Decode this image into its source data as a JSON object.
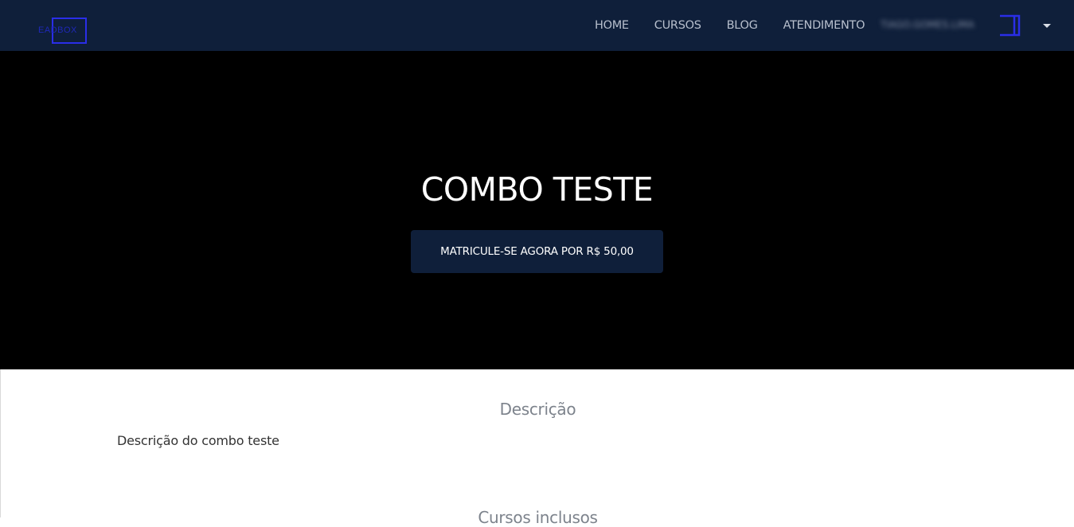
{
  "logo": {
    "text": "EADBOX",
    "accent_color": "#2a2ee8"
  },
  "nav": {
    "items": [
      {
        "label": "HOME"
      },
      {
        "label": "CURSOS"
      },
      {
        "label": "BLOG"
      },
      {
        "label": "ATENDIMENTO"
      }
    ],
    "user_name": "TIAGO.GOMES.LIMA",
    "user_icon": "user-avatar-icon",
    "menu_icon": "caret-down-icon"
  },
  "hero": {
    "title": "COMBO TESTE",
    "enroll_label": "MATRICULE-SE AGORA POR R$ 50,00"
  },
  "description": {
    "heading": "Descrição",
    "text": "Descrição do combo teste"
  },
  "courses": {
    "heading": "Cursos inclusos"
  },
  "colors": {
    "navbar_bg": "#0f1f3a",
    "hero_bg": "#000000",
    "button_bg": "#0f1f3a"
  }
}
